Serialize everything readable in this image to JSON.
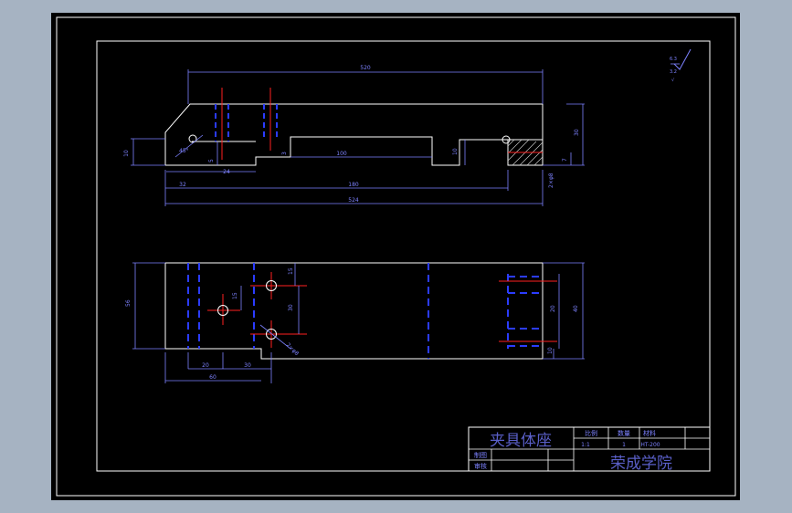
{
  "colors": {
    "background": "#a6b3c2",
    "paper": "#000000",
    "outline": "#ffffff",
    "dimension": "#7d82ff",
    "centerline": "#ff2020",
    "hidden": "#2b3cff",
    "title_text": "#5a5fc8"
  },
  "front_view": {
    "dims": {
      "overall_top": "520",
      "left_height": "10",
      "chamfer": "45°",
      "slot_depth": "5",
      "slot_width": "24",
      "step_height": "3",
      "groove_length": "100",
      "right_height": "10",
      "total_height": "30",
      "small_step": "7",
      "hole_note": "2×φ8",
      "left_offset": "32",
      "mid_length": "180",
      "bottom_total": "524"
    }
  },
  "top_view": {
    "dims": {
      "width_left": "56",
      "hole_spacing_v": "15",
      "hole_offset": "15",
      "pitch_v": "30",
      "hole_note": "2×φ8",
      "pos_a": "20",
      "pos_b": "30",
      "base_len": "60",
      "right_total": "40",
      "right_mid": "20",
      "right_small": "10"
    }
  },
  "roughness": {
    "value1": "6.3",
    "value2": "3.2"
  },
  "title_block": {
    "part_name": "夹具体座",
    "header_scale": "比例",
    "header_qty": "数量",
    "header_material": "材料",
    "scale_value": "1:1",
    "qty_value": "1",
    "material_value": "HT-200",
    "row_drafter": "制图",
    "row_checker": "审核",
    "school": "荣成学院"
  }
}
